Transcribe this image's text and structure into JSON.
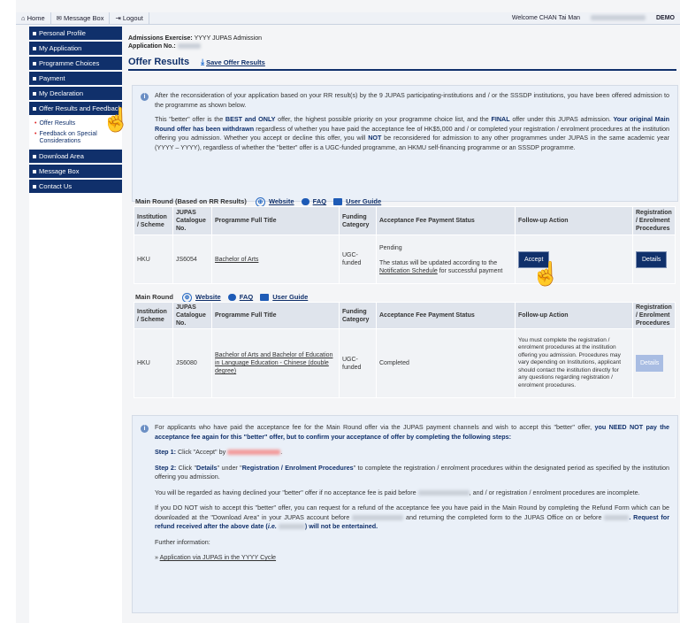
{
  "topbar": {
    "home": "Home",
    "message_box": "Message Box",
    "logout": "Logout",
    "welcome": "Welcome CHAN Tai Man",
    "demo": "DEMO"
  },
  "sidebar": {
    "items": [
      {
        "label": "Personal Profile"
      },
      {
        "label": "My Application"
      },
      {
        "label": "Programme Choices"
      },
      {
        "label": "Payment"
      },
      {
        "label": "My Declaration"
      },
      {
        "label": "Offer Results and Feedback"
      }
    ],
    "subitems": [
      {
        "label": "Offer Results"
      },
      {
        "label": "Feedback on Special Considerations"
      }
    ],
    "items2": [
      {
        "label": "Download Area"
      },
      {
        "label": "Message Box"
      },
      {
        "label": "Contact Us"
      }
    ]
  },
  "header": {
    "exercise_label": "Admissions Exercise:",
    "exercise_value": "YYYY JUPAS Admission",
    "appno_label": "Application No.:",
    "page_title": "Offer Results",
    "save_link": "Save Offer Results"
  },
  "info1": {
    "p1": "After the reconsideration of your application based on your RR result(s) by the 9 JUPAS participating-institutions and / or the SSSDP institutions, you have been offered admission to the programme as shown below.",
    "p2a": "This \"better\" offer is the ",
    "p2b": "BEST and ONLY",
    "p2c": " offer, the highest possible priority on your programme choice list, and the ",
    "p2d": "FINAL",
    "p2e": " offer under this JUPAS admission. ",
    "p2f": "Your original Main Round offer has been withdrawn",
    "p2g": " regardless of whether you have paid the acceptance fee of HK$5,000 and / or completed your registration / enrolment procedures at the institution offering you admission. Whether you accept or decline this offer, you will ",
    "p2h": "NOT",
    "p2i": " be reconsidered for admission to any other programmes under JUPAS in the same academic year (YYYY – YYYY), regardless of whether the \"better\" offer is a UGC-funded programme, an HKMU self-financing programme or an SSSDP programme."
  },
  "table1": {
    "title": "Main Round (Based on RR Results)",
    "website": "Website",
    "faq": "FAQ",
    "guide": "User Guide",
    "headers": [
      "Institution / Scheme",
      "JUPAS Catalogue No.",
      "Programme Full Title",
      "Funding Category",
      "Acceptance Fee Payment Status",
      "Follow-up Action",
      "Registration / Enrolment Procedures"
    ],
    "row": {
      "institution": "HKU",
      "catalogue": "JS6054",
      "programme": "Bachelor of Arts",
      "funding": "UGC-funded",
      "status_1": "Pending",
      "status_2a": "The status will be updated according to the ",
      "status_2b": "Notification Schedule",
      "status_2c": " for successful payment",
      "action": "Accept",
      "details": "Details"
    }
  },
  "table2": {
    "title": "Main Round",
    "website": "Website",
    "faq": "FAQ",
    "guide": "User Guide",
    "headers": [
      "Institution / Scheme",
      "JUPAS Catalogue No.",
      "Programme Full Title",
      "Funding Category",
      "Acceptance Fee Payment Status",
      "Follow-up Action",
      "Registration / Enrolment Procedures"
    ],
    "row": {
      "institution": "HKU",
      "catalogue": "JS6080",
      "programme": "Bachelor of Arts and Bachelor of Education in Language Education - Chinese (double degree)",
      "funding": "UGC-funded",
      "status": "Completed",
      "action": "You must complete the registration / enrolment procedures at the institution offering you admission. Procedures may vary depending on Institutions, applicant should contact the institution directly for any questions regarding registration / enrolment procedures.",
      "details": "Details"
    }
  },
  "info2": {
    "p1a": "For applicants who have paid the acceptance fee for the Main Round offer via the JUPAS payment channels and wish to accept this \"better\" offer, ",
    "p1b": "you NEED NOT pay the acceptance fee again for this \"better\" offer, but to confirm your acceptance of offer by completing the following steps:",
    "s1a": "Step 1:",
    "s1b": " Click \"Accept\" by ",
    "s2a": "Step 2:",
    "s2b": " Click \"",
    "s2c": "Details",
    "s2d": "\" under \"",
    "s2e": "Registration / Enrolment Procedures",
    "s2f": "\" to complete the registration / enrolment procedures within the designated period as specified by the institution offering you admission.",
    "p3a": "You will be regarded as having declined your \"better\" offer if no acceptance fee is paid before ",
    "p3b": ", and / or registration / enrolment procedures are incomplete.",
    "p4a": "If you DO NOT wish to accept this \"better\" offer, you can request for a refund of the acceptance fee you have paid in the Main Round by completing the Refund Form which can be downloaded at the \"Download Area\" in your JUPAS account before ",
    "p4b": " and returning the completed form to the JUPAS Office on or before ",
    "p4c": ". Request for refund received after the above date (",
    "p4d": "i.e.",
    "p4e": ") will not be entertained.",
    "further": "Further information:",
    "link": "Application via JUPAS in the YYYY Cycle"
  }
}
